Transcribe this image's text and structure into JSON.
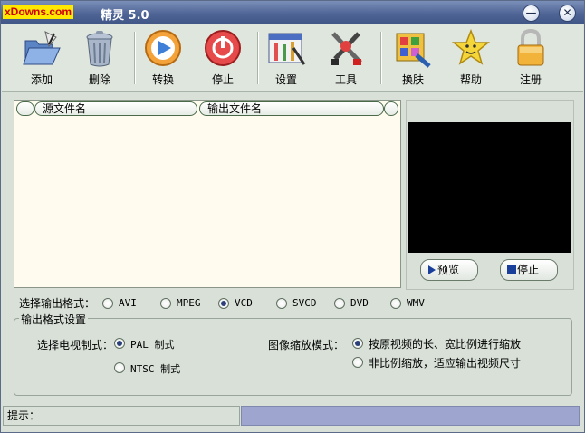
{
  "window": {
    "logo_text": "xDowns.com",
    "title": "精灵 5.0",
    "minimize_glyph": "—",
    "close_glyph": "✕"
  },
  "toolbar": {
    "items": [
      {
        "label": "添加",
        "icon": "open-folder-icon"
      },
      {
        "label": "删除",
        "icon": "trash-can-icon"
      },
      {
        "label": "转换",
        "icon": "play-circle-icon"
      },
      {
        "label": "停止",
        "icon": "power-stop-icon"
      },
      {
        "label": "设置",
        "icon": "settings-window-icon"
      },
      {
        "label": "工具",
        "icon": "tools-icon"
      },
      {
        "label": "换肤",
        "icon": "skin-palette-icon"
      },
      {
        "label": "帮助",
        "icon": "smiley-star-icon"
      },
      {
        "label": "注册",
        "icon": "padlock-icon"
      }
    ]
  },
  "file_list": {
    "columns": [
      "源文件名",
      "输出文件名"
    ],
    "rows": []
  },
  "preview": {
    "play_label": "预览",
    "stop_label": "停止"
  },
  "output_format": {
    "label": "选择输出格式：",
    "options": [
      "AVI",
      "MPEG",
      "VCD",
      "SVCD",
      "DVD",
      "WMV"
    ],
    "selected": "VCD"
  },
  "settings_group": {
    "title": "输出格式设置",
    "tv_standard_label": "选择电视制式：",
    "tv_options": [
      "PAL  制式",
      "NTSC 制式"
    ],
    "tv_selected": "PAL  制式",
    "scale_label": "图像缩放模式：",
    "scale_options": [
      "按原视频的长、宽比例进行缩放",
      "非比例缩放，适应输出视频尺寸"
    ],
    "scale_selected": "按原视频的长、宽比例进行缩放"
  },
  "status": {
    "hint_label": "提示："
  },
  "colors": {
    "background": "#d8e0d8",
    "titlebar": "#4f6595",
    "list_background": "#fffbee",
    "progress": "#9ea6cf"
  }
}
